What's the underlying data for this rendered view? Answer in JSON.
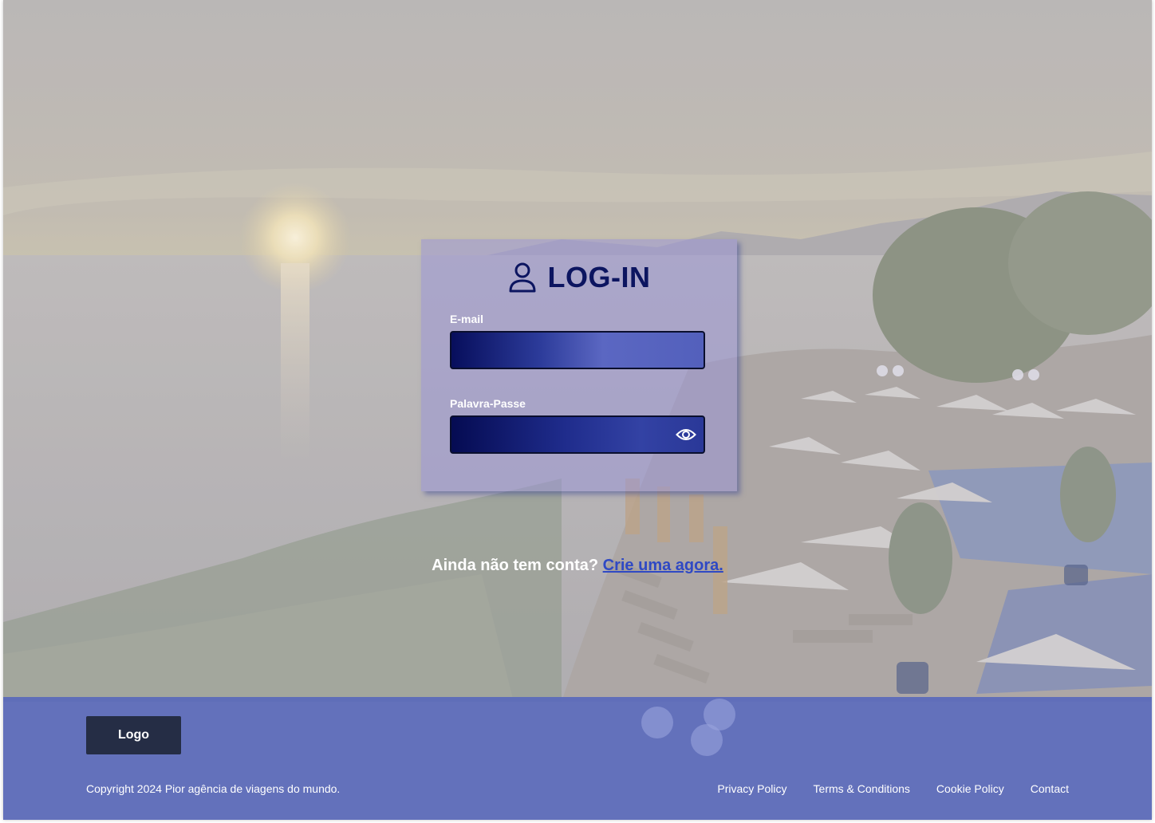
{
  "login": {
    "title": "LOG-IN",
    "email_label": "E-mail",
    "email_value": "",
    "password_label": "Palavra-Passe",
    "password_value": ""
  },
  "signup": {
    "prompt": "Ainda não tem conta?",
    "link": "Crie uma agora."
  },
  "footer": {
    "logo": "Logo",
    "copyright": "Copyright 2024 Pior agência de viagens do mundo.",
    "links": [
      "Privacy Policy",
      "Terms & Conditions",
      "Cookie Policy",
      "Contact"
    ]
  },
  "icons": {
    "user": "user-icon",
    "eye": "eye-icon"
  },
  "colors": {
    "title": "#0c1560",
    "link": "#2f49c4",
    "footer_bg": "#5868bc",
    "logo_bg": "#252d45"
  }
}
